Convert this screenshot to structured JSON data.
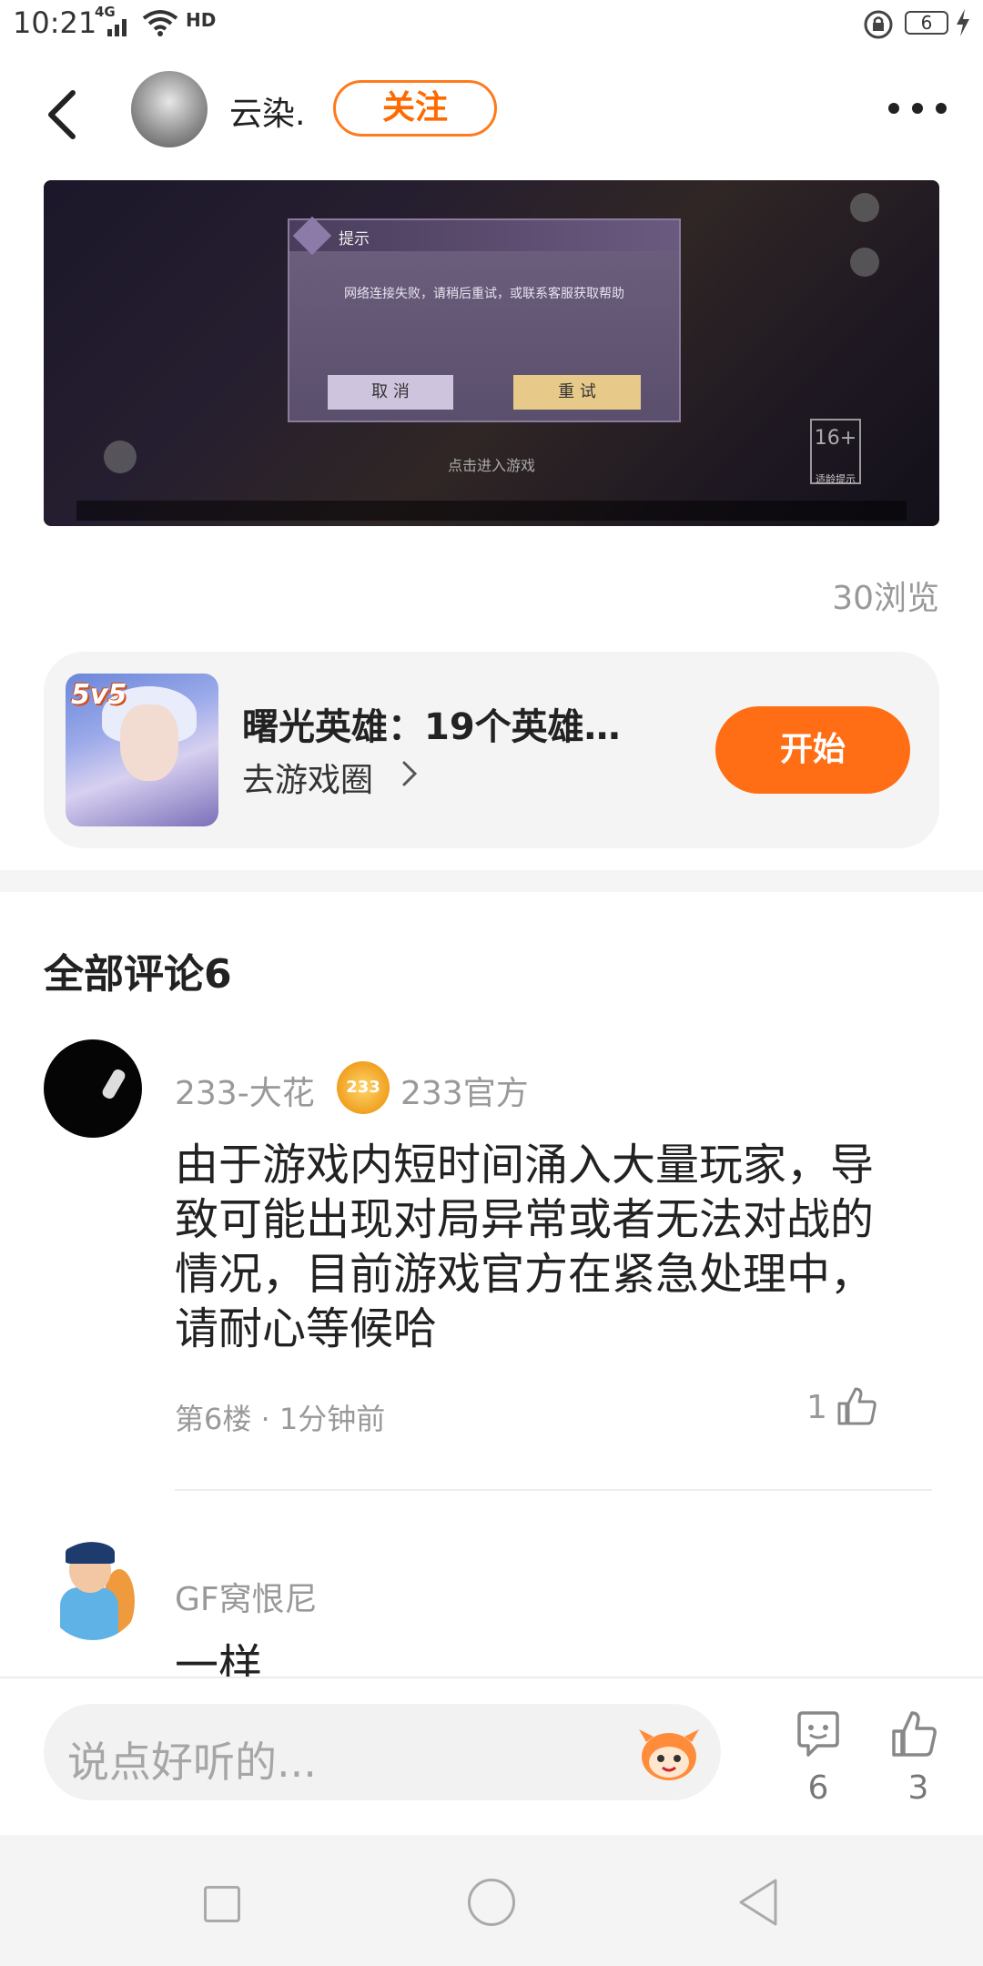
{
  "status_bar": {
    "time": "10:21",
    "network": "4G",
    "hd": "HD",
    "battery": "6"
  },
  "header": {
    "author_name": "云染.",
    "follow_label": "关注"
  },
  "post_image": {
    "dialog_title": "提示",
    "dialog_message": "网络连接失败，请稍后重试，或联系客服获取帮助",
    "cancel_label": "取 消",
    "retry_label": "重 试",
    "enter_game": "点击进入游戏",
    "age_rating": "16+",
    "age_tip": "适龄提示"
  },
  "views": "30浏览",
  "game_card": {
    "icon_badge": "5v5",
    "title": "曙光英雄：19个英雄…",
    "link_label": "去游戏圈",
    "start_label": "开始"
  },
  "comments": {
    "heading": "全部评论6",
    "items": [
      {
        "name": "233-大花",
        "badge_icon_text": "233",
        "badge_label": "233官方",
        "body": "由于游戏内短时间涌入大量玩家，导致可能出现对局异常或者无法对战的情况，目前游戏官方在紧急处理中，请耐心等候哈",
        "meta": "第6楼 · 1分钟前",
        "likes": "1"
      },
      {
        "name": "GF窝恨尼",
        "body": "一样"
      }
    ]
  },
  "bottom_bar": {
    "input_placeholder": "说点好听的...",
    "comment_count": "6",
    "like_count": "3"
  },
  "colors": {
    "accent": "#ff6e14",
    "muted_text": "#999999",
    "card_bg": "#f4f4f4"
  }
}
